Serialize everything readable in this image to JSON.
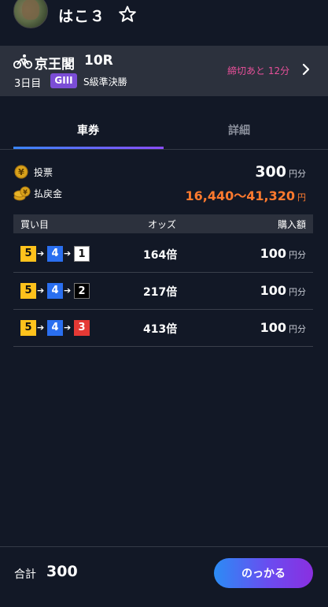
{
  "header": {
    "user_name": "はこ３"
  },
  "race": {
    "venue": "京王閣",
    "race_no": "10R",
    "day": "3日目",
    "grade": "GIII",
    "class": "S級準決勝",
    "deadline": "締切あと 12分"
  },
  "tabs": [
    {
      "label": "車券",
      "active": true
    },
    {
      "label": "詳細",
      "active": false
    }
  ],
  "summary": {
    "bet_label": "投票",
    "bet_amount": "300",
    "bet_unit": "円分",
    "payout_label": "払戻金",
    "payout_range": "16,440〜41,320",
    "payout_unit": "円"
  },
  "table": {
    "headers": [
      "買い目",
      "オッズ",
      "購入額"
    ],
    "rows": [
      {
        "combo": [
          "5",
          "4",
          "1"
        ],
        "odds": "164倍",
        "amount": "100",
        "unit": "円分"
      },
      {
        "combo": [
          "5",
          "4",
          "2"
        ],
        "odds": "217倍",
        "amount": "100",
        "unit": "円分"
      },
      {
        "combo": [
          "5",
          "4",
          "3"
        ],
        "odds": "413倍",
        "amount": "100",
        "unit": "円分"
      }
    ],
    "arrow": "➔"
  },
  "footer": {
    "total_label": "合計",
    "total_value": "300",
    "button_label": "のっかる"
  },
  "colors": {
    "background": "#121826",
    "accent_pink": "#e8509a",
    "payout_orange": "#ff7a2e",
    "grade_purple": "#7b4dd6",
    "car_colors": {
      "1": "#ffffff",
      "2": "#000000",
      "3": "#e53935",
      "4": "#2a6ff0",
      "5": "#ffc21c"
    }
  },
  "icons": [
    "star-outline-icon",
    "bicycle-icon",
    "chevron-right-icon",
    "yen-coin-icon",
    "coins-stack-icon",
    "arrow-right-icon"
  ]
}
